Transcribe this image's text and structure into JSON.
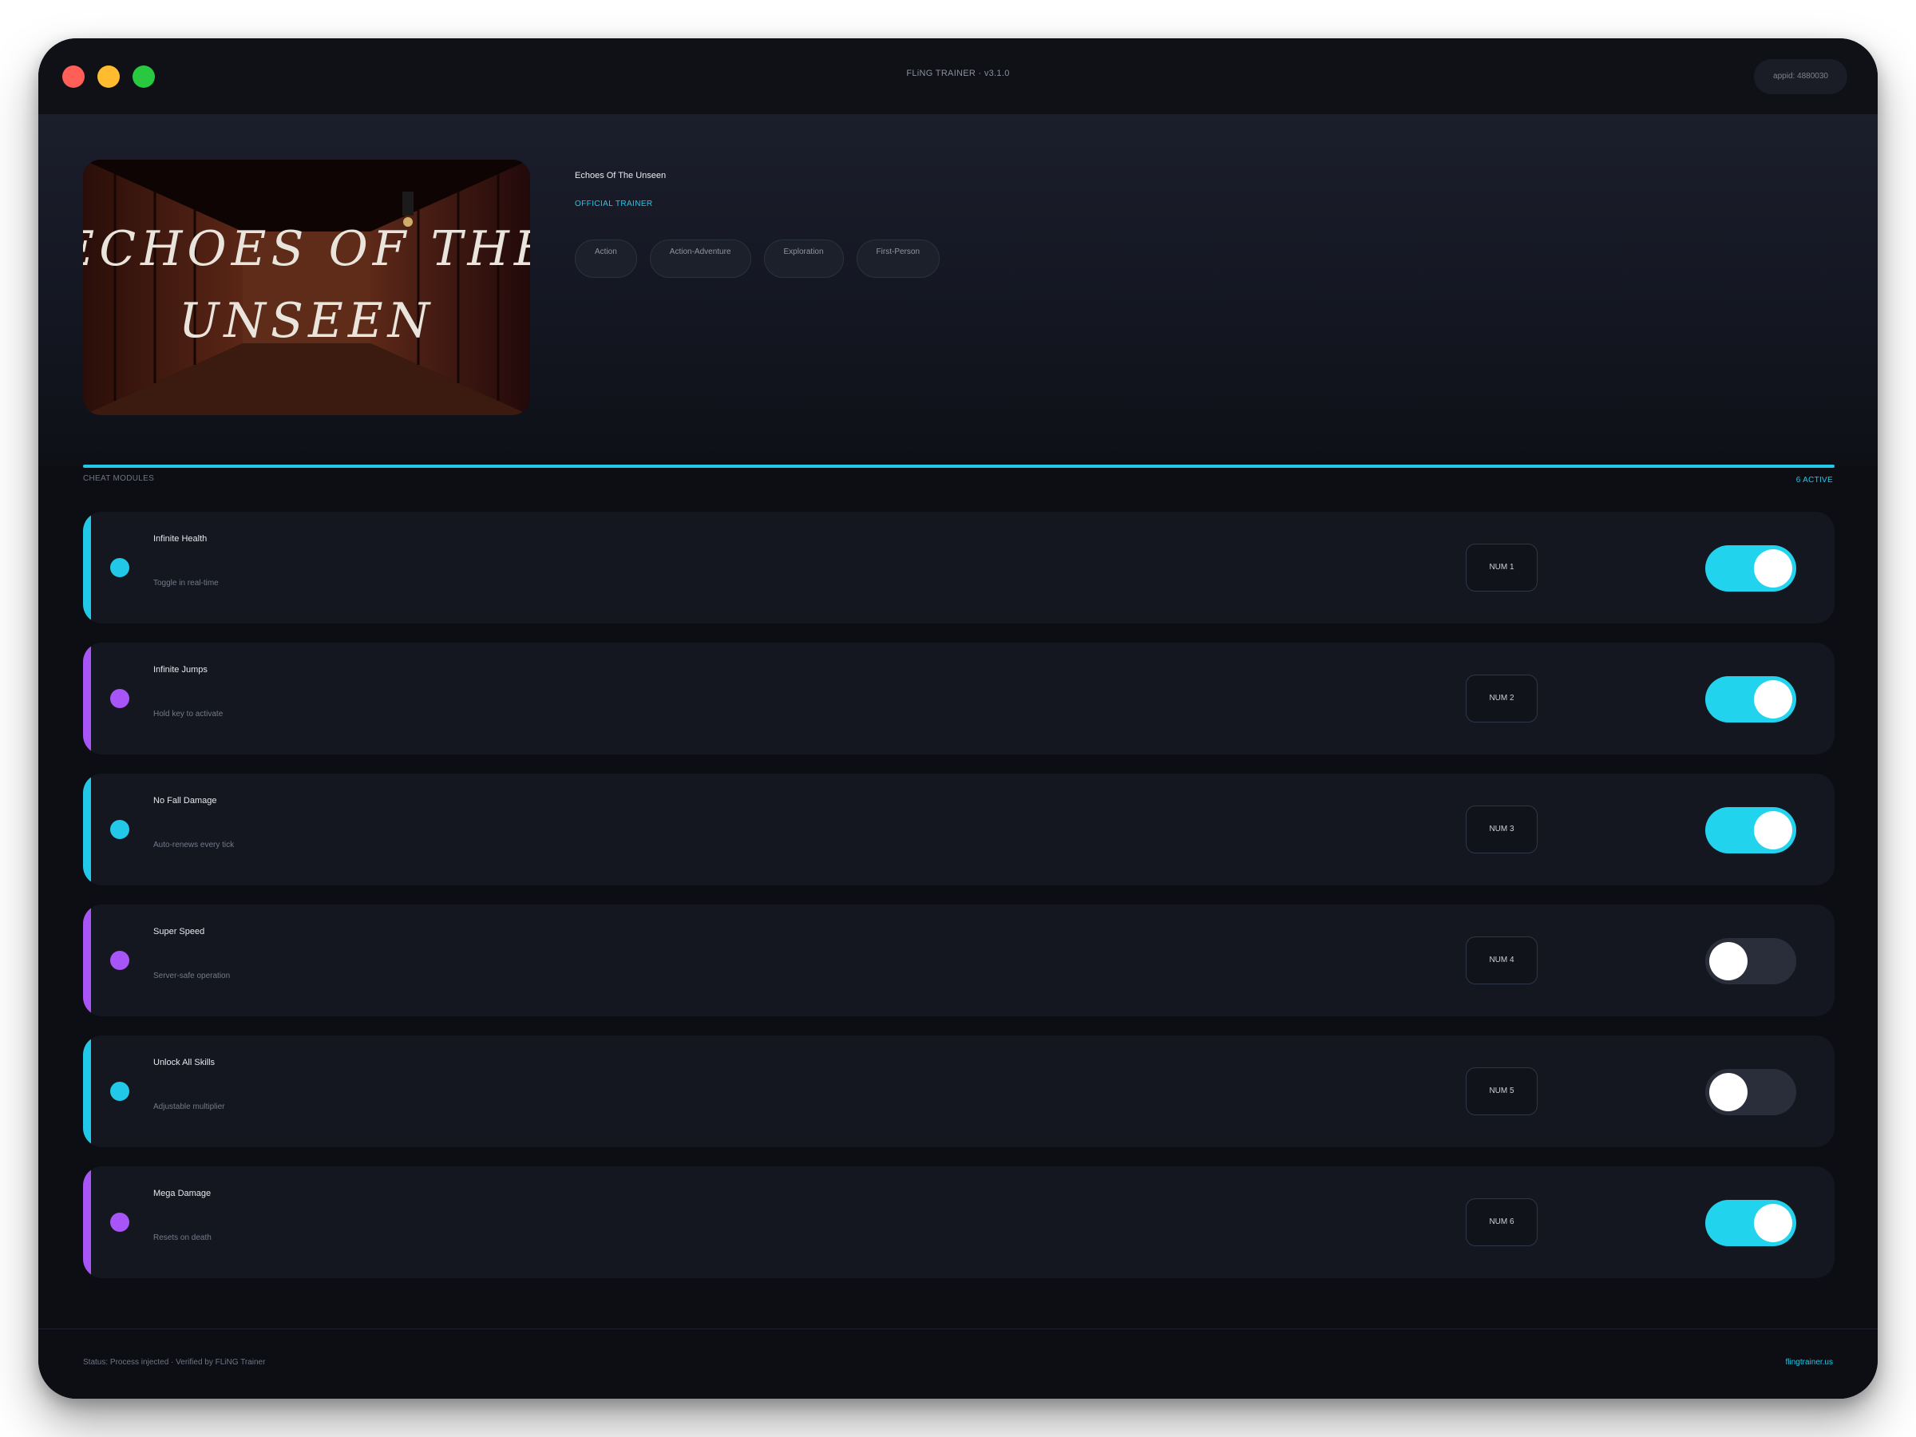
{
  "window": {
    "title": "FLiNG TRAINER · v3.1.0",
    "appid": "appid: 4880030"
  },
  "game": {
    "title": "Echoes Of The Unseen",
    "badge": "OFFICIAL TRAINER",
    "cover_text_line1": "ECHOES OF THE",
    "cover_text_line2": "UNSEEN",
    "tags": [
      "Action",
      "Action-Adventure",
      "Exploration",
      "First-Person"
    ]
  },
  "modules_section": {
    "label": "CHEAT MODULES",
    "active_count": "6 ACTIVE"
  },
  "modules": [
    {
      "name": "Infinite Health",
      "desc": "Toggle in real-time",
      "hotkey": "NUM 1",
      "enabled": true,
      "accent": "#22c8e8"
    },
    {
      "name": "Infinite Jumps",
      "desc": "Hold key to activate",
      "hotkey": "NUM 2",
      "enabled": true,
      "accent": "#a855f7"
    },
    {
      "name": "No Fall Damage",
      "desc": "Auto-renews every tick",
      "hotkey": "NUM 3",
      "enabled": true,
      "accent": "#22c8e8"
    },
    {
      "name": "Super Speed",
      "desc": "Server-safe operation",
      "hotkey": "NUM 4",
      "enabled": false,
      "accent": "#a855f7"
    },
    {
      "name": "Unlock All Skills",
      "desc": "Adjustable multiplier",
      "hotkey": "NUM 5",
      "enabled": false,
      "accent": "#22c8e8"
    },
    {
      "name": "Mega Damage",
      "desc": "Resets on death",
      "hotkey": "NUM 6",
      "enabled": true,
      "accent": "#a855f7"
    }
  ],
  "footer": {
    "status": "Status: Process injected · Verified by FLiNG Trainer",
    "site": "flingtrainer.us"
  },
  "colors": {
    "accent_cyan": "#22c8e8",
    "accent_purple": "#a855f7",
    "toggle_on": "#22d3ee",
    "toggle_off": "#2a2e3a"
  },
  "icons": {
    "close": "close-icon",
    "minimize": "minimize-icon",
    "maximize": "maximize-icon"
  }
}
